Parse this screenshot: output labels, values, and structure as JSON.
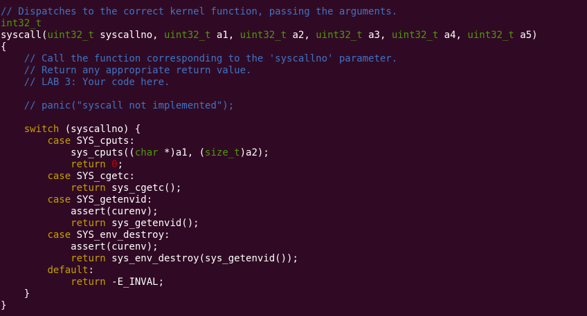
{
  "colors": {
    "background": "#300a24",
    "plain": "#ffffff",
    "comment": "#3f74c4",
    "type": "#4e9a06",
    "keyword": "#c4a000",
    "number": "#cc0000"
  },
  "code": {
    "lines": [
      [
        {
          "t": "comment",
          "v": "// Dispatches to the correct kernel function, passing the arguments."
        }
      ],
      [
        {
          "t": "type",
          "v": "int32_t"
        }
      ],
      [
        {
          "t": "plain",
          "v": "syscall("
        },
        {
          "t": "type",
          "v": "uint32_t"
        },
        {
          "t": "plain",
          "v": " syscallno, "
        },
        {
          "t": "type",
          "v": "uint32_t"
        },
        {
          "t": "plain",
          "v": " a1, "
        },
        {
          "t": "type",
          "v": "uint32_t"
        },
        {
          "t": "plain",
          "v": " a2, "
        },
        {
          "t": "type",
          "v": "uint32_t"
        },
        {
          "t": "plain",
          "v": " a3, "
        },
        {
          "t": "type",
          "v": "uint32_t"
        },
        {
          "t": "plain",
          "v": " a4, "
        },
        {
          "t": "type",
          "v": "uint32_t"
        },
        {
          "t": "plain",
          "v": " a5)"
        }
      ],
      [
        {
          "t": "plain",
          "v": "{"
        }
      ],
      [
        {
          "t": "plain",
          "v": "    "
        },
        {
          "t": "comment",
          "v": "// Call the function corresponding to the 'syscallno' parameter."
        }
      ],
      [
        {
          "t": "plain",
          "v": "    "
        },
        {
          "t": "comment",
          "v": "// Return any appropriate return value."
        }
      ],
      [
        {
          "t": "plain",
          "v": "    "
        },
        {
          "t": "comment",
          "v": "// LAB 3: Your code here."
        }
      ],
      [],
      [
        {
          "t": "plain",
          "v": "    "
        },
        {
          "t": "comment",
          "v": "// panic(\"syscall not implemented\");"
        }
      ],
      [],
      [
        {
          "t": "plain",
          "v": "    "
        },
        {
          "t": "keyword",
          "v": "switch"
        },
        {
          "t": "plain",
          "v": " (syscallno) {"
        }
      ],
      [
        {
          "t": "plain",
          "v": "        "
        },
        {
          "t": "keyword",
          "v": "case"
        },
        {
          "t": "plain",
          "v": " SYS_cputs:"
        }
      ],
      [
        {
          "t": "plain",
          "v": "            sys_cputs(("
        },
        {
          "t": "type",
          "v": "char"
        },
        {
          "t": "plain",
          "v": " *)a1, ("
        },
        {
          "t": "type",
          "v": "size_t"
        },
        {
          "t": "plain",
          "v": ")a2);"
        }
      ],
      [
        {
          "t": "plain",
          "v": "            "
        },
        {
          "t": "keyword",
          "v": "return"
        },
        {
          "t": "plain",
          "v": " "
        },
        {
          "t": "number",
          "v": "0"
        },
        {
          "t": "plain",
          "v": ";"
        }
      ],
      [
        {
          "t": "plain",
          "v": "        "
        },
        {
          "t": "keyword",
          "v": "case"
        },
        {
          "t": "plain",
          "v": " SYS_cgetc:"
        }
      ],
      [
        {
          "t": "plain",
          "v": "            "
        },
        {
          "t": "keyword",
          "v": "return"
        },
        {
          "t": "plain",
          "v": " sys_cgetc();"
        }
      ],
      [
        {
          "t": "plain",
          "v": "        "
        },
        {
          "t": "keyword",
          "v": "case"
        },
        {
          "t": "plain",
          "v": " SYS_getenvid:"
        }
      ],
      [
        {
          "t": "plain",
          "v": "            assert(curenv);"
        }
      ],
      [
        {
          "t": "plain",
          "v": "            "
        },
        {
          "t": "keyword",
          "v": "return"
        },
        {
          "t": "plain",
          "v": " sys_getenvid();"
        }
      ],
      [
        {
          "t": "plain",
          "v": "        "
        },
        {
          "t": "keyword",
          "v": "case"
        },
        {
          "t": "plain",
          "v": " SYS_env_destroy:"
        }
      ],
      [
        {
          "t": "plain",
          "v": "            assert(curenv);"
        }
      ],
      [
        {
          "t": "plain",
          "v": "            "
        },
        {
          "t": "keyword",
          "v": "return"
        },
        {
          "t": "plain",
          "v": " sys_env_destroy(sys_getenvid());"
        }
      ],
      [
        {
          "t": "plain",
          "v": "        "
        },
        {
          "t": "keyword",
          "v": "default"
        },
        {
          "t": "plain",
          "v": ":"
        }
      ],
      [
        {
          "t": "plain",
          "v": "            "
        },
        {
          "t": "keyword",
          "v": "return"
        },
        {
          "t": "plain",
          "v": " -E_INVAL;"
        }
      ],
      [
        {
          "t": "plain",
          "v": "    }"
        }
      ],
      [
        {
          "t": "plain",
          "v": "}"
        }
      ]
    ]
  }
}
